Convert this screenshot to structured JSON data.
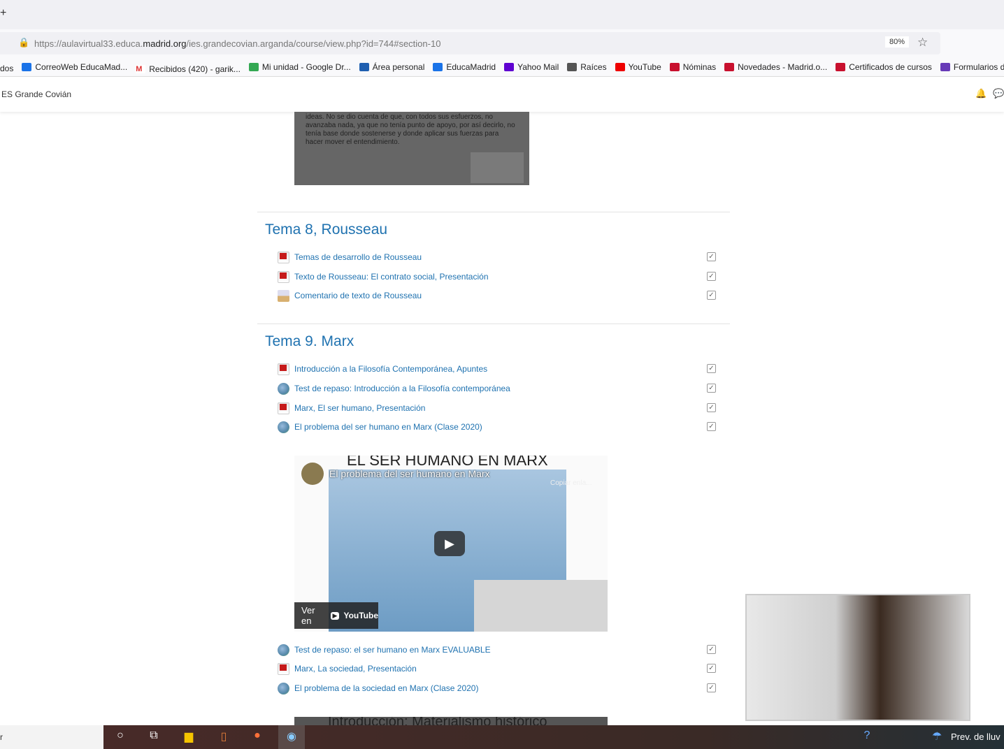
{
  "browser": {
    "url_prefix": "https://aulavirtual33.educa.",
    "url_domain": "madrid.org",
    "url_path": "/ies.grandecovian.arganda/course/view.php?id=744#section-10",
    "zoom": "80%",
    "bookmarks": [
      "dos",
      "CorreoWeb EducaMad...",
      "Recibidos (420) - garik...",
      "Mi unidad - Google Dr...",
      "Área personal",
      "EducaMadrid",
      "Yahoo Mail",
      "Raíces",
      "YouTube",
      "Nóminas",
      "Novedades - Madrid.o...",
      "Certificados de cursos",
      "Formularios de"
    ]
  },
  "site": {
    "name": "ES Grande Covián"
  },
  "top_image_text": "ideas. No se dio cuenta de que, con todos sus esfuerzos, no avanzaba nada, ya que no tenía punto de apoyo, por así decirlo, no tenía base donde sostenerse y donde aplicar sus fuerzas para hacer mover el entendimiento.",
  "sections": [
    {
      "title": "Tema 8, Rousseau",
      "items": [
        {
          "label": "Temas de desarrollo de Rousseau",
          "type": "pdf"
        },
        {
          "label": "Texto de Rousseau: El contrato social, Presentación",
          "type": "pdf"
        },
        {
          "label": "Comentario de texto de Rousseau",
          "type": "assign"
        }
      ]
    },
    {
      "title": "Tema 9. Marx",
      "items": [
        {
          "label": "Introducción a la Filosofía Contemporánea, Apuntes",
          "type": "pdf"
        },
        {
          "label": "Test de repaso: Introducción a la Filosofía contemporánea",
          "type": "quiz"
        },
        {
          "label": "Marx, El ser humano, Presentación",
          "type": "pdf"
        },
        {
          "label": "El problema del ser humano en Marx (Clase 2020)",
          "type": "quiz"
        },
        {
          "label": "Test de repaso: el ser humano en Marx EVALUABLE",
          "type": "quiz"
        },
        {
          "label": "Marx, La sociedad, Presentación",
          "type": "pdf"
        },
        {
          "label": "El problema de la sociedad en Marx (Clase 2020)",
          "type": "quiz"
        }
      ]
    }
  ],
  "video": {
    "heading": "EL SER HUMANO EN MARX",
    "title": "El problema del ser humano en Marx",
    "copy": "Copiar enla...",
    "watch_on": "Ver en",
    "youtube": "YouTube"
  },
  "next_video": {
    "heading": "Introducción: Materialismo histórico"
  },
  "taskbar": {
    "search": "r",
    "weather": "Prev. de lluv"
  }
}
